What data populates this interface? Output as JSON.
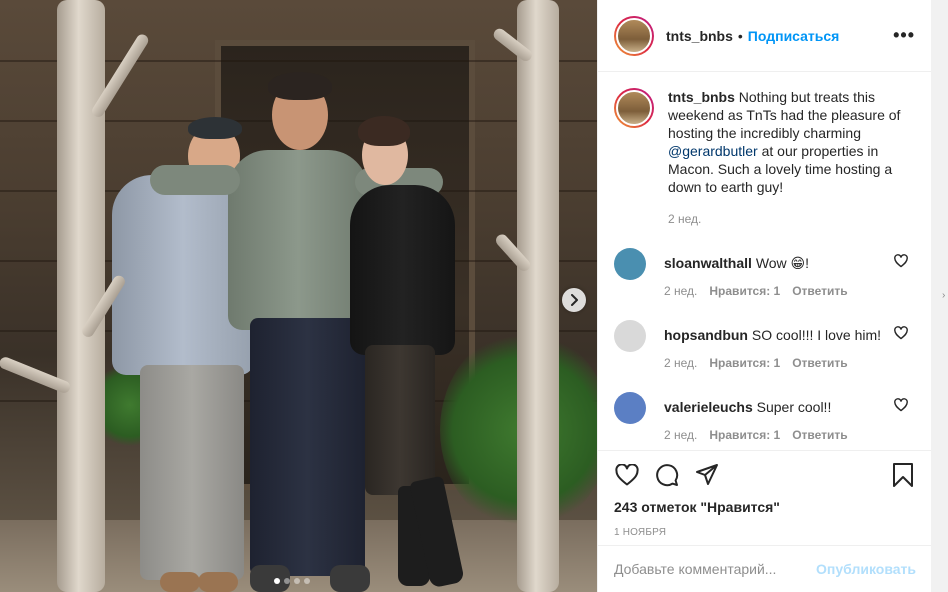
{
  "post": {
    "username": "tnts_bnbs",
    "follow_label": "Подписаться",
    "more_label": "•••",
    "caption": {
      "username": "tnts_bnbs",
      "text_before": "Nothing but treats this weekend as TnTs had the pleasure of hosting the incredibly charming ",
      "mention": "@gerardbutler",
      "text_after": " at our properties in Macon. Such a lovely time hosting a down to earth guy!",
      "time": "2 нед."
    },
    "comments": [
      {
        "username": "sloanwalthall",
        "text": "Wow 😁!",
        "time": "2 нед.",
        "likes": "Нравится: 1",
        "reply": "Ответить",
        "avatar_color": "#4a8fb0"
      },
      {
        "username": "hopsandbun",
        "text": "SO cool!!! I love him!",
        "time": "2 нед.",
        "likes": "Нравится: 1",
        "reply": "Ответить",
        "avatar_color": "#d9d9d9"
      },
      {
        "username": "valerieleuchs",
        "text": "Super cool!!",
        "time": "2 нед.",
        "likes": "Нравится: 1",
        "reply": "Ответить",
        "avatar_color": "#5b7fc4"
      }
    ],
    "likes_text": "243 отметок \"Нравится\"",
    "date": "1 ноября",
    "add_comment_placeholder": "Добавьте комментарий...",
    "publish_label": "Опубликовать",
    "carousel": {
      "total": 4,
      "current": 1
    }
  },
  "icons": [
    "heart-icon",
    "comment-icon",
    "share-icon",
    "bookmark-icon",
    "chevron-right-icon",
    "more-icon"
  ]
}
